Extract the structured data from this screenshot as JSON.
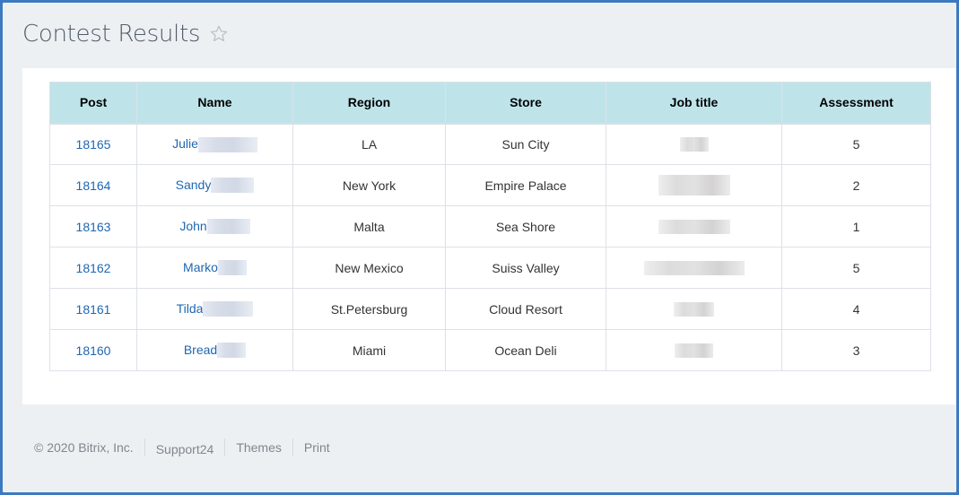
{
  "page": {
    "title": "Contest Results",
    "favorite_icon": "star-outline-icon"
  },
  "table": {
    "columns": [
      "Post",
      "Name",
      "Region",
      "Store",
      "Job title",
      "Assessment"
    ],
    "rows": [
      {
        "post": "18165",
        "name": "Julie",
        "region": "LA",
        "store": "Sun City",
        "job_title": "[redacted]",
        "assessment": "5"
      },
      {
        "post": "18164",
        "name": "Sandy",
        "region": "New York",
        "store": "Empire Palace",
        "job_title": "[redacted]",
        "assessment": "2"
      },
      {
        "post": "18163",
        "name": "John",
        "region": "Malta",
        "store": "Sea Shore",
        "job_title": "[redacted]",
        "assessment": "1"
      },
      {
        "post": "18162",
        "name": "Marko",
        "region": "New Mexico",
        "store": "Suiss Valley",
        "job_title": "[redacted]",
        "assessment": "5"
      },
      {
        "post": "18161",
        "name": "Tilda",
        "region": "St.Petersburg",
        "store": "Cloud Resort",
        "job_title": "[redacted]",
        "assessment": "4"
      },
      {
        "post": "18160",
        "name": "Bread",
        "region": "Miami",
        "store": "Ocean Deli",
        "job_title": "[redacted]",
        "assessment": "3"
      }
    ]
  },
  "footer": {
    "copyright": "© 2020 Bitrix, Inc.",
    "links": [
      "Support24",
      "Themes",
      "Print"
    ]
  },
  "colors": {
    "frame_border": "#3d79c1",
    "header_bg": "#bee4ea",
    "link": "#2067b0",
    "page_bg": "#edf0f3"
  }
}
